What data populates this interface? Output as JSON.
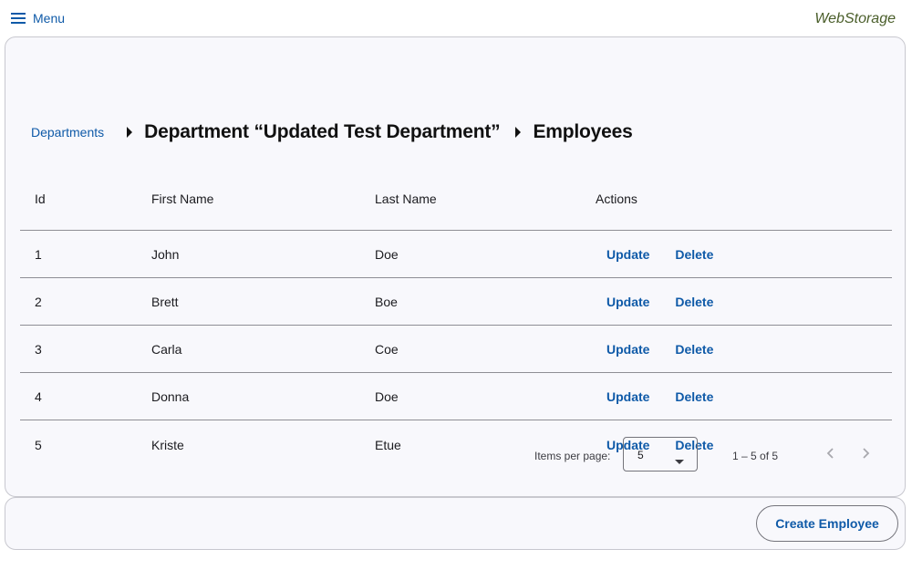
{
  "header": {
    "menu_label": "Menu",
    "menu_icon": "hamburger-icon",
    "brand": "WebStorage"
  },
  "breadcrumb": {
    "departments_link": "Departments",
    "department_title": "Department “Updated Test Department”",
    "current_title": "Employees",
    "separator_icon": "caret-right-icon"
  },
  "table": {
    "columns": [
      "Id",
      "First Name",
      "Last Name",
      "Actions"
    ],
    "rows": [
      {
        "id": "1",
        "first": "John",
        "last": "Doe"
      },
      {
        "id": "2",
        "first": "Brett",
        "last": "Boe"
      },
      {
        "id": "3",
        "first": "Carla",
        "last": "Coe"
      },
      {
        "id": "4",
        "first": "Donna",
        "last": "Doe"
      },
      {
        "id": "5",
        "first": "Kriste",
        "last": "Etue"
      }
    ],
    "update_label": "Update",
    "delete_label": "Delete"
  },
  "paginator": {
    "items_per_page_label": "Items per page:",
    "items_per_page_value": "5",
    "range_label": "1 – 5 of 5"
  },
  "footer": {
    "create_label": "Create Employee"
  },
  "colors": {
    "accent": "#0f5aa8",
    "brand": "#4a5e2a",
    "card_bg": "#f8f8fc"
  }
}
